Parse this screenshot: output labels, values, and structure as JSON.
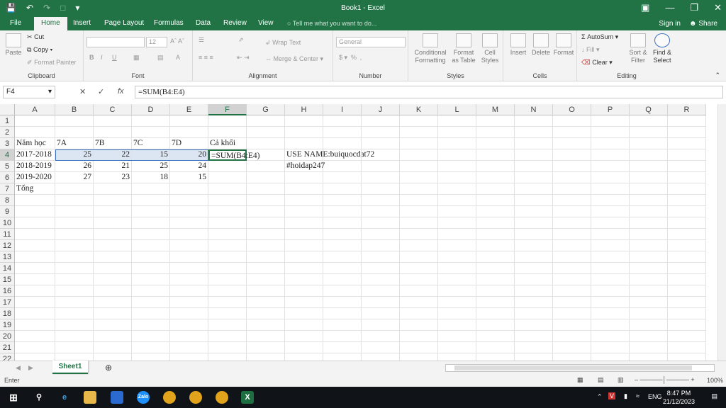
{
  "window": {
    "title": "Book1 - Excel"
  },
  "tabs": [
    "File",
    "Home",
    "Insert",
    "Page Layout",
    "Formulas",
    "Data",
    "Review",
    "View"
  ],
  "tell_me": "Tell me what you want to do...",
  "account": {
    "signin": "Sign in",
    "share": "Share"
  },
  "ribbon": {
    "clipboard": {
      "label": "Clipboard",
      "paste": "Paste",
      "cut": "Cut",
      "copy": "Copy",
      "format_painter": "Format Painter"
    },
    "font": {
      "label": "Font",
      "size": "12"
    },
    "alignment": {
      "label": "Alignment",
      "wrap": "Wrap Text",
      "merge": "Merge & Center"
    },
    "number": {
      "label": "Number",
      "format": "General"
    },
    "styles": {
      "label": "Styles",
      "cond": "Conditional Formatting",
      "table": "Format as Table",
      "cell": "Cell Styles"
    },
    "cells": {
      "label": "Cells",
      "insert": "Insert",
      "delete": "Delete",
      "format": "Format"
    },
    "editing": {
      "label": "Editing",
      "autosum": "AutoSum",
      "fill": "Fill",
      "clear": "Clear",
      "sort": "Sort & Filter",
      "find": "Find & Select"
    }
  },
  "formula_bar": {
    "name_box": "F4",
    "formula": "=SUM(B4:E4)"
  },
  "columns": [
    "A",
    "B",
    "C",
    "D",
    "E",
    "F",
    "G",
    "H",
    "I",
    "J",
    "K",
    "L",
    "M",
    "N",
    "O",
    "P",
    "Q",
    "R"
  ],
  "rows": [
    "1",
    "2",
    "3",
    "4",
    "5",
    "6",
    "7",
    "8",
    "9",
    "10",
    "11",
    "12",
    "13",
    "14",
    "15",
    "16",
    "17",
    "18",
    "19",
    "20",
    "21",
    "22"
  ],
  "cells": {
    "A3": "Năm học",
    "B3": "7A",
    "C3": "7B",
    "D3": "7C",
    "E3": "7D",
    "F3": "Cả khối",
    "A4": "2017-2018",
    "B4": "25",
    "C4": "22",
    "D4": "15",
    "E4": "20",
    "F4": "=SUM(B4:E4)",
    "A5": "2018-2019",
    "B5": "26",
    "C5": "21",
    "D5": "25",
    "E5": "24",
    "A6": "2019-2020",
    "B6": "27",
    "C6": "23",
    "D6": "18",
    "E6": "15",
    "A7": "Tổng",
    "H4": "USE NAME:buiquocdat72",
    "H5": "#hoidap247"
  },
  "sheet": {
    "name": "Sheet1"
  },
  "status": {
    "mode": "Enter",
    "zoom": "100%"
  },
  "taskbar": {
    "lang": "ENG",
    "time": "8:47 PM",
    "date": "21/12/2023"
  }
}
